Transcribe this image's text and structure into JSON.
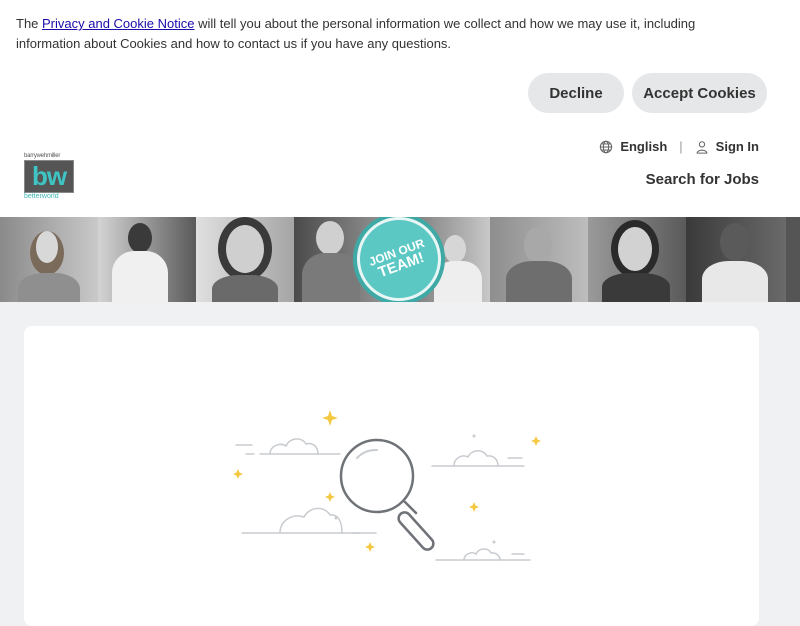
{
  "cookie": {
    "text_before": "The ",
    "link": "Privacy and Cookie Notice",
    "text_after": " will tell you about the personal information we collect and how we may use it, including information about Cookies and how to contact us if you have any questions.",
    "decline_label": "Decline",
    "accept_label": "Accept Cookies"
  },
  "header": {
    "logo": {
      "top": "barrywehmiller",
      "mark": "bw",
      "bottom": "betterworld"
    },
    "language": "English",
    "sign_in": "Sign In",
    "separator": "|",
    "search_jobs": "Search for Jobs"
  },
  "banner": {
    "badge": {
      "line1": "JOIN OUR",
      "line2": "TEAM!"
    }
  },
  "colors": {
    "accent": "#3fb6b6",
    "button_bg": "#e6e7e8",
    "page_bg": "#f0f1f2"
  },
  "icons": [
    "globe-icon",
    "user-icon",
    "magnifier-illustration"
  ]
}
